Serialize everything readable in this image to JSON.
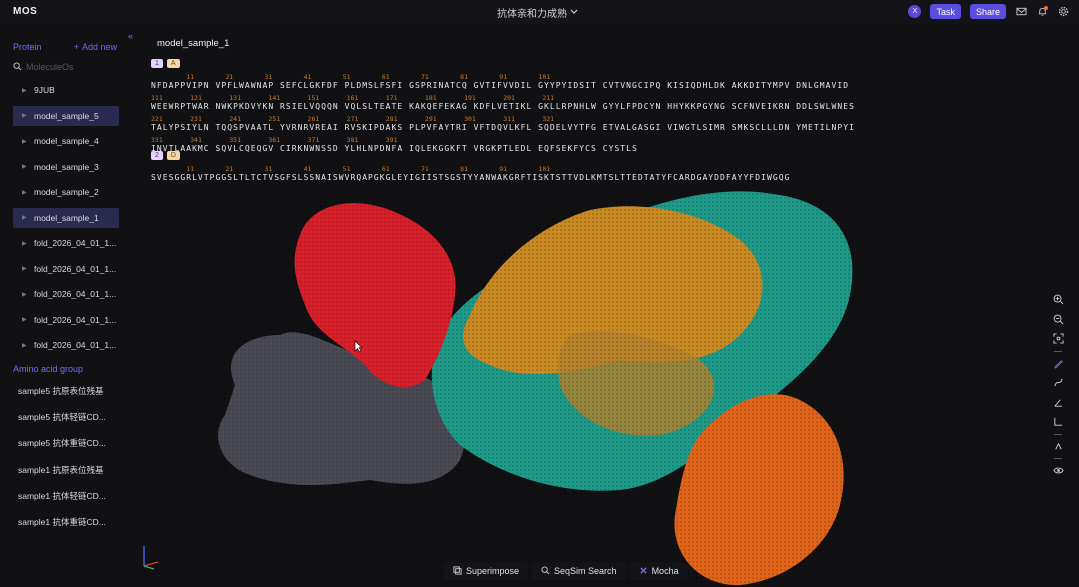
{
  "topbar": {
    "app_name": "MOS",
    "project_title": "抗体亲和力成熟",
    "avatar_initial": "X",
    "task_label": "Task",
    "share_label": "Share"
  },
  "sidebar": {
    "protein_heading": "Protein",
    "add_new_label": "Add new",
    "search_placeholder": "MoleculeOs",
    "proteins": [
      {
        "label": "9JUB",
        "selected": false
      },
      {
        "label": "model_sample_5",
        "selected": true
      },
      {
        "label": "model_sample_4",
        "selected": false
      },
      {
        "label": "model_sample_3",
        "selected": false
      },
      {
        "label": "model_sample_2",
        "selected": false
      },
      {
        "label": "model_sample_1",
        "selected": true
      },
      {
        "label": "fold_2026_04_01_1...",
        "selected": false
      },
      {
        "label": "fold_2026_04_01_1...",
        "selected": false
      },
      {
        "label": "fold_2026_04_01_1...",
        "selected": false
      },
      {
        "label": "fold_2026_04_01_1...",
        "selected": false
      },
      {
        "label": "fold_2026_04_01_1...",
        "selected": false
      }
    ],
    "amino_group_heading": "Amino acid group",
    "groups": [
      {
        "label": "sample5 抗原表位残基"
      },
      {
        "label": "sample5 抗体轻链CD..."
      },
      {
        "label": "sample5 抗体重链CD..."
      },
      {
        "label": "sample1 抗原表位残基"
      },
      {
        "label": "sample1 抗体轻链CD..."
      },
      {
        "label": "sample1 抗体重链CD..."
      }
    ]
  },
  "main": {
    "model_title": "model_sample_1",
    "chains": [
      {
        "chain_tag": "1",
        "chain_id": "A",
        "rows": [
          {
            "nums": "         11        21        31        41        51        61        71        81        91        101",
            "seq": "NFDAPPVIPN VPFLWAWNAP SEFCLGKFDF PLDMSLFSFI GSPRINATCQ GVTIFVVDIL GYYPYIDSIT CVTVNGCIPQ KISIQDHLDK AKKDITYMPV DNLGMAVID"
          },
          {
            "nums": "111       121       131       141       151       161       171       181       191       201       211",
            "seq": "WEEWRPTWAR NWKPKDVYKN RSIELVQQQN VQLSLTEATE KAKQEFEKAG KDFLVETIKL GKLLRPNHLW GYYLFPDCYN HHYKKPGYNG SCFNVEIKRN DDLSWLWNES"
          },
          {
            "nums": "221       231       241       251       261       271       281       291       301       311       321",
            "seq": "TALYPSIYLN TQQSPVAATL YVRNRVREAI RVSKIPDAKS PLPVFAYTRI VFTDQVLKFL SQDELVYTFG ETVALGASGI VIWGTLSIMR SMKSCLLLDN YMETILNPYI"
          },
          {
            "nums": "331       341       351       361       371       381       391",
            "seq": "INVTLAAKMC SQVLCQEQGV CIRKNWNSSD YLHLNPDNFA IQLEKGGKFT VRGKPTLEDL EQFSEKFYCS CYSTLS"
          }
        ]
      },
      {
        "chain_tag": "2",
        "chain_id": "D",
        "rows": [
          {
            "nums": "         11        21        31        41        51        61        71        81        91        101",
            "seq": "SVESGGRLVTPGGSLTLTCTVSGFSLSSNAISWVRQAPGKGLEYIGIISTSGSTYYANWAKGRFTISKTSTTVDLKMTSLTTEDTATYFCARDGAYDDFAYYFDIWGQG"
          }
        ]
      }
    ]
  },
  "viewer": {
    "toolbar": [
      "zoom-in-icon",
      "zoom-out-icon",
      "fit-view-icon",
      "pen-icon",
      "curve-icon",
      "measure-angle-icon",
      "measure-distance-icon",
      "reset-icon",
      "eye-icon"
    ]
  },
  "bottom": {
    "superimpose_label": "Superimpose",
    "seqsim_label": "SeqSim Search",
    "mocha_label": "Mocha"
  },
  "colors": {
    "accent": "#5a4de0",
    "chain_red": "#d8202a",
    "chain_gold": "#c98a24",
    "chain_teal": "#1f9a88",
    "chain_orange": "#e0641a",
    "chain_gray": "#4a4a55"
  }
}
